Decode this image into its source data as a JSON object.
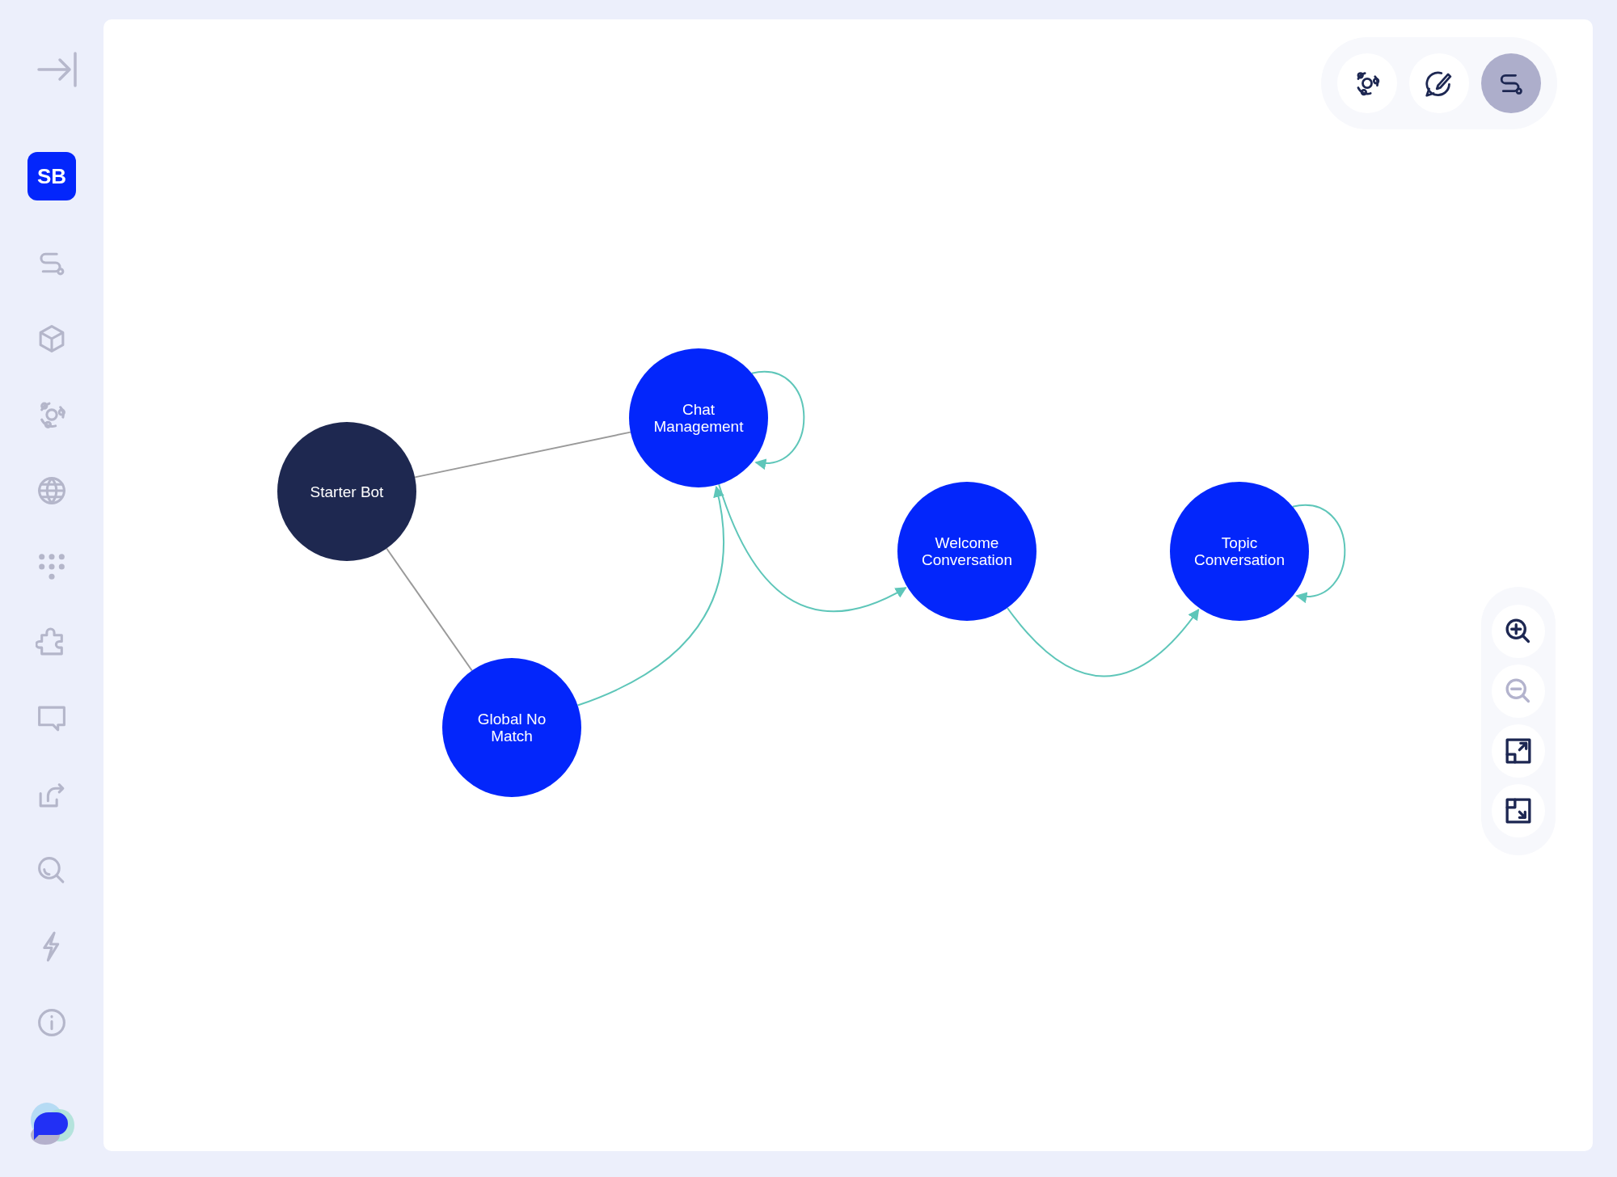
{
  "sidebar": {
    "workspace_badge": "SB"
  },
  "toolbar": {
    "buttons": [
      {
        "selected": false
      },
      {
        "selected": false
      },
      {
        "selected": true
      }
    ]
  },
  "zoom_controls": [
    {
      "disabled": false
    },
    {
      "disabled": true
    },
    {
      "disabled": false
    },
    {
      "disabled": false
    }
  ],
  "graph": {
    "nodes": [
      {
        "label": "Starter Bot",
        "kind": "root"
      },
      {
        "label": "Chat Management",
        "kind": "topic"
      },
      {
        "label": "Welcome Conversation",
        "kind": "topic"
      },
      {
        "label": "Topic Conversation",
        "kind": "topic"
      },
      {
        "label": "Global No Match",
        "kind": "topic"
      }
    ],
    "edges": [
      {
        "kind": "link"
      },
      {
        "kind": "link"
      },
      {
        "kind": "flow"
      },
      {
        "kind": "flow"
      },
      {
        "kind": "flow"
      },
      {
        "kind": "flow"
      },
      {
        "kind": "flow"
      }
    ]
  }
}
